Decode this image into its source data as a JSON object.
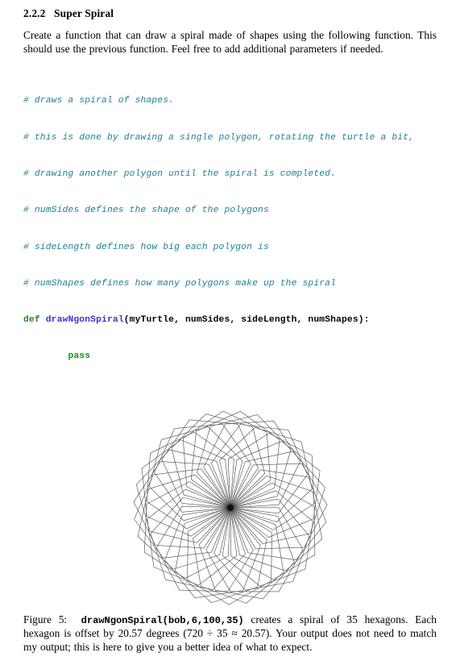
{
  "document": {
    "section": {
      "number": "2.2.2",
      "title": "Super Spiral"
    },
    "intro_paragraph": "Create a function that can draw a spiral made of shapes using the following function. This should use the previous function. Feel free to add additional parameters if needed.",
    "code": {
      "lines": [
        {
          "type": "comment",
          "text": "# draws a spiral of shapes."
        },
        {
          "type": "comment",
          "text": "# this is done by drawing a single polygon, rotating the turtle a bit,"
        },
        {
          "type": "comment",
          "text": "# drawing another polygon until the spiral is completed."
        },
        {
          "type": "comment",
          "text": "# numSides defines the shape of the polygons"
        },
        {
          "type": "comment",
          "text": "# sideLength defines how big each polygon is"
        },
        {
          "type": "comment",
          "text": "# numShapes defines how many polygons make up the spiral"
        }
      ],
      "def_keyword": "def",
      "function_name": "drawNgonSpiral",
      "signature_rest": "(myTurtle, numSides, sideLength, numShapes):",
      "body_statement": "pass",
      "body_indent": "        ",
      "colors": {
        "comment": "#1f7f94",
        "keyword": "#287f27",
        "function_name": "#3c32c8",
        "pass_keyword": "#0a9b0a",
        "plain": "#000000"
      }
    },
    "figure": {
      "label": "Figure 5:",
      "code_ref": "drawNgonSpiral(bob,6,100,35)",
      "caption_part1": "creates a spiral of 35 hexagons. Each hexagon is offset by 20.57 degrees (720 ÷ 35 ≈ 20.57). Your output does not need to match my output; this is here to give you a better idea of what to expect.",
      "stroke_color": "#4a4a4a",
      "background": "#ffffff",
      "num_shapes": 35,
      "num_sides": 6,
      "side_length": 100,
      "rotation_degrees": 20.57,
      "shape_name": "hexagon",
      "center_marker_color": "#111111"
    }
  },
  "chart_data": {
    "type": "line",
    "title": "drawNgonSpiral(bob,6,100,35)",
    "description": "Turtle-graphics spirograph: 35 regular hexagons drawn from a common origin, each successive hexagon rotated 20.57 degrees (720/35) about the start point.",
    "num_shapes": 35,
    "num_sides": 6,
    "side_length": 100,
    "rotation_step_deg": 20.57,
    "total_rotation_deg": 720,
    "xlabel": "",
    "ylabel": "",
    "grid": false,
    "legend": "none"
  }
}
